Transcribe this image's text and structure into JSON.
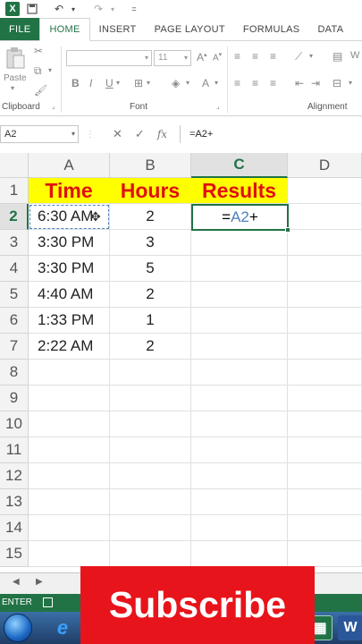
{
  "colors": {
    "excel_green": "#217346",
    "header_fill": "#ffff00",
    "header_text": "#e01010",
    "subscribe_bg": "#e8141b",
    "ref_blue": "#4f81bd"
  },
  "qat": {
    "icons": [
      "excel-icon",
      "save-icon",
      "undo-icon",
      "redo-icon"
    ],
    "more": "="
  },
  "tabs": [
    {
      "label": "FILE"
    },
    {
      "label": "HOME"
    },
    {
      "label": "INSERT"
    },
    {
      "label": "PAGE LAYOUT"
    },
    {
      "label": "FORMULAS"
    },
    {
      "label": "DATA"
    }
  ],
  "ribbon": {
    "paste_label": "Paste",
    "font_size_value": "11",
    "group_clipboard": "Clipboard",
    "group_font": "Font",
    "group_alignment": "Alignment",
    "bold": "B",
    "italic": "I",
    "underline": "U",
    "wrap_partial": "W"
  },
  "formula_bar": {
    "name_box": "A2",
    "cancel": "✕",
    "enter": "✓",
    "fx": "fx",
    "formula": "=A2+"
  },
  "sheet": {
    "columns": [
      "A",
      "B",
      "C",
      "D"
    ],
    "rows": [
      "1",
      "2",
      "3",
      "4",
      "5",
      "6",
      "7",
      "8",
      "9",
      "10",
      "11",
      "12",
      "13",
      "14",
      "15"
    ],
    "headers": [
      "Time",
      "Hours",
      "Results"
    ],
    "data": [
      {
        "time": "6:30 AM",
        "hours": "2"
      },
      {
        "time": "3:30 PM",
        "hours": "3"
      },
      {
        "time": "3:30 PM",
        "hours": "5"
      },
      {
        "time": "4:40 AM",
        "hours": "2"
      },
      {
        "time": "1:33 PM",
        "hours": "1"
      },
      {
        "time": "2:22 AM",
        "hours": "2"
      }
    ],
    "editing_cell": {
      "prefix": "=",
      "ref": "A2",
      "suffix": "+"
    }
  },
  "statusbar": {
    "mode": "ENTER"
  },
  "overlay": {
    "subscribe": "Subscribe"
  }
}
